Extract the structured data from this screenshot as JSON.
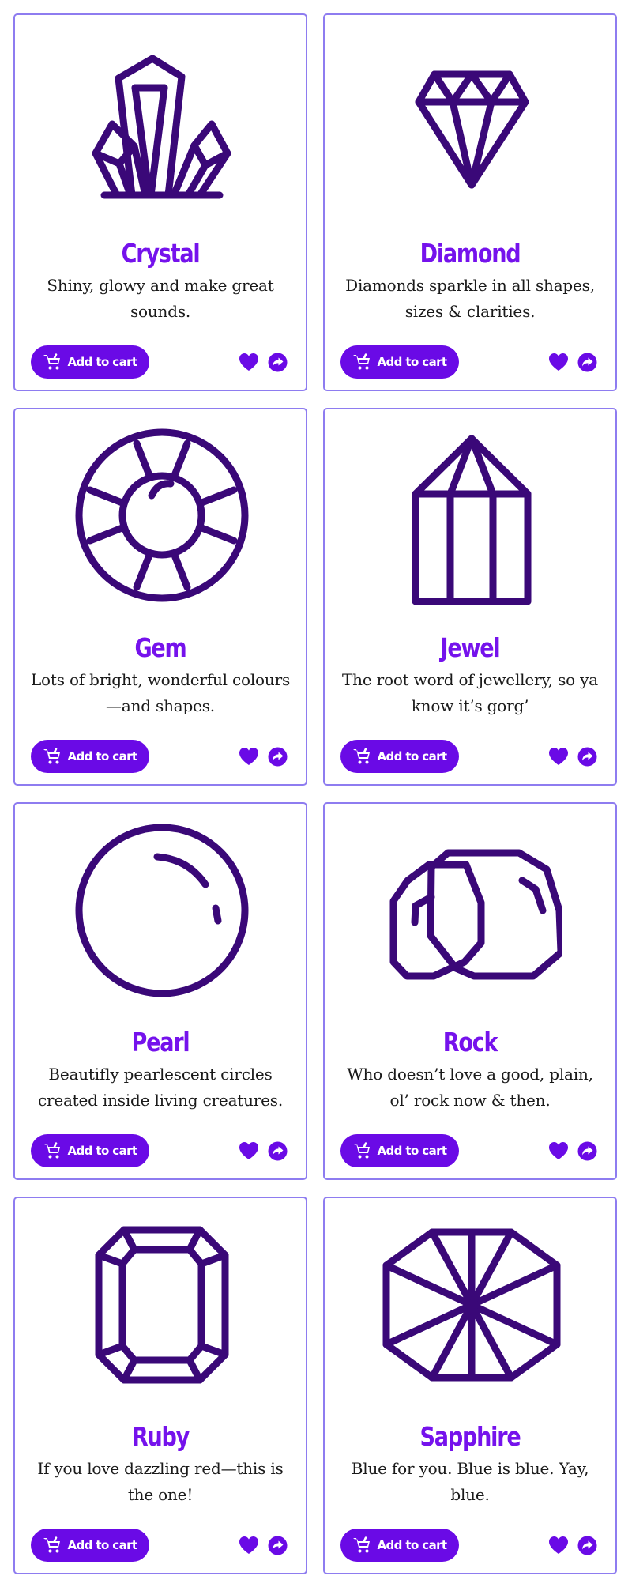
{
  "colors": {
    "accent": "#6a0ae6",
    "title": "#7512ec",
    "border": "#8e7cf0",
    "icon_stroke": "#3a0878"
  },
  "button_label": "Add to cart",
  "cards": [
    {
      "title": "Crystal",
      "description": "Shiny, glowy and make great sounds.",
      "icon": "crystal-icon"
    },
    {
      "title": "Diamond",
      "description": "Diamonds sparkle in all shapes, sizes & clarities.",
      "icon": "diamond-icon"
    },
    {
      "title": "Gem",
      "description": "Lots of bright, wonderful colours—and shapes.",
      "icon": "gem-icon"
    },
    {
      "title": "Jewel",
      "description": "The root word of jewellery, so ya know it’s gorg’",
      "icon": "jewel-icon"
    },
    {
      "title": "Pearl",
      "description": "Beautifly pearlescent circles created inside living creatures.",
      "icon": "pearl-icon"
    },
    {
      "title": "Rock",
      "description": "Who doesn’t love a good, plain, ol’ rock now & then.",
      "icon": "rock-icon"
    },
    {
      "title": "Ruby",
      "description": "If you love dazzling red—this is the one!",
      "icon": "ruby-icon"
    },
    {
      "title": "Sapphire",
      "description": "Blue for you. Blue is blue. Yay, blue.",
      "icon": "sapphire-icon"
    }
  ]
}
